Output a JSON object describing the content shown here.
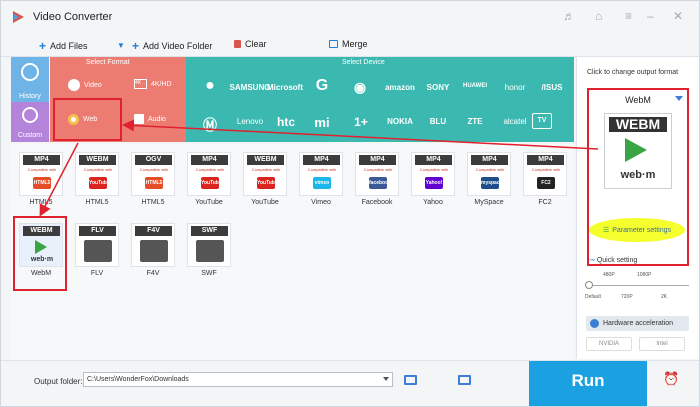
{
  "app": {
    "title": "Video Converter"
  },
  "toolbar": {
    "add_files": "Add Files",
    "add_video_folder": "Add Video Folder",
    "clear": "Clear",
    "merge": "Merge"
  },
  "sections": {
    "select_format": "Select Format",
    "select_device": "Select Device"
  },
  "left_tabs": [
    {
      "label": "History"
    },
    {
      "label": "Custom"
    }
  ],
  "format_categories": [
    {
      "label": "Video"
    },
    {
      "label": "4K/HD"
    },
    {
      "label": "Web"
    },
    {
      "label": "Audio"
    }
  ],
  "devices_row1": [
    "",
    "SAMSUNG",
    "Microsoft",
    "G",
    "",
    "amazon",
    "SONY",
    "HUAWEI",
    "honor",
    "/ISUS"
  ],
  "devices_row2": [
    "",
    "Lenovo",
    "htc",
    "mi",
    "1+",
    "NOKIA",
    "BLU",
    "ZTE",
    "alcatel",
    "TV"
  ],
  "tiles": [
    {
      "badge": "MP4",
      "sub": "Compatible with",
      "mark": "HTML5",
      "mark_color": "#e44d26",
      "name": "HTML5"
    },
    {
      "badge": "WEBM",
      "sub": "Compatible with",
      "mark": "YouTube",
      "mark_color": "#d9251d",
      "name": "HTML5"
    },
    {
      "badge": "OGV",
      "sub": "Compatible with",
      "mark": "HTML5",
      "mark_color": "#e44d26",
      "name": "HTML5"
    },
    {
      "badge": "MP4",
      "sub": "Compatible with",
      "mark": "YouTube",
      "mark_color": "#d9251d",
      "name": "YouTube"
    },
    {
      "badge": "WEBM",
      "sub": "Compatible with",
      "mark": "YouTube",
      "mark_color": "#d9251d",
      "name": "YouTube"
    },
    {
      "badge": "MP4",
      "sub": "Compatible with",
      "mark": "vimeo",
      "mark_color": "#1ab7ea",
      "name": "Vimeo"
    },
    {
      "badge": "MP4",
      "sub": "Compatible with",
      "mark": "facebook",
      "mark_color": "#3b5998",
      "name": "Facebook"
    },
    {
      "badge": "MP4",
      "sub": "Compatible with",
      "mark": "Yahoo!",
      "mark_color": "#6001d2",
      "name": "Yahoo"
    },
    {
      "badge": "MP4",
      "sub": "Compatible with",
      "mark": "myspace",
      "mark_color": "#1d4e89",
      "name": "MySpace"
    },
    {
      "badge": "MP4",
      "sub": "Compatible with",
      "mark": "FC2",
      "mark_color": "#222222",
      "name": "FC2"
    },
    {
      "badge": "WEBM",
      "sub": "",
      "mark": "web·m",
      "mark_color": "#3aa545",
      "name": "WebM"
    },
    {
      "badge": "FLV",
      "sub": "",
      "mark": "",
      "mark_color": "#444444",
      "name": "FLV"
    },
    {
      "badge": "F4V",
      "sub": "",
      "mark": "",
      "mark_color": "#444444",
      "name": "F4V"
    },
    {
      "badge": "SWF",
      "sub": "",
      "mark": "",
      "mark_color": "#444444",
      "name": "SWF"
    }
  ],
  "right": {
    "hint": "Click to change output format",
    "output_format": "WebM",
    "badge": "WEBM",
    "wordmark": "web·m",
    "param_settings": "Parameter settings",
    "quick_setting": "Quick setting",
    "slider_top": [
      "480P",
      "1080P"
    ],
    "slider_bottom": [
      "Default",
      "720P",
      "2K"
    ],
    "hw_accel": "Hardware acceleration",
    "nvidia": "NVIDIA",
    "intel": "Intel"
  },
  "bottom": {
    "output_folder_label": "Output folder:",
    "output_path": "C:\\Users\\WonderFox\\Downloads",
    "run": "Run"
  },
  "colors": {
    "format_panel": "#ec7c72",
    "device_panel": "#3bb8b0",
    "history": "#6fb4e6",
    "custom": "#b384d9",
    "run": "#1ba1e2",
    "highlight_box": "#e0212f",
    "param_highlight": "#f5ff2e"
  }
}
